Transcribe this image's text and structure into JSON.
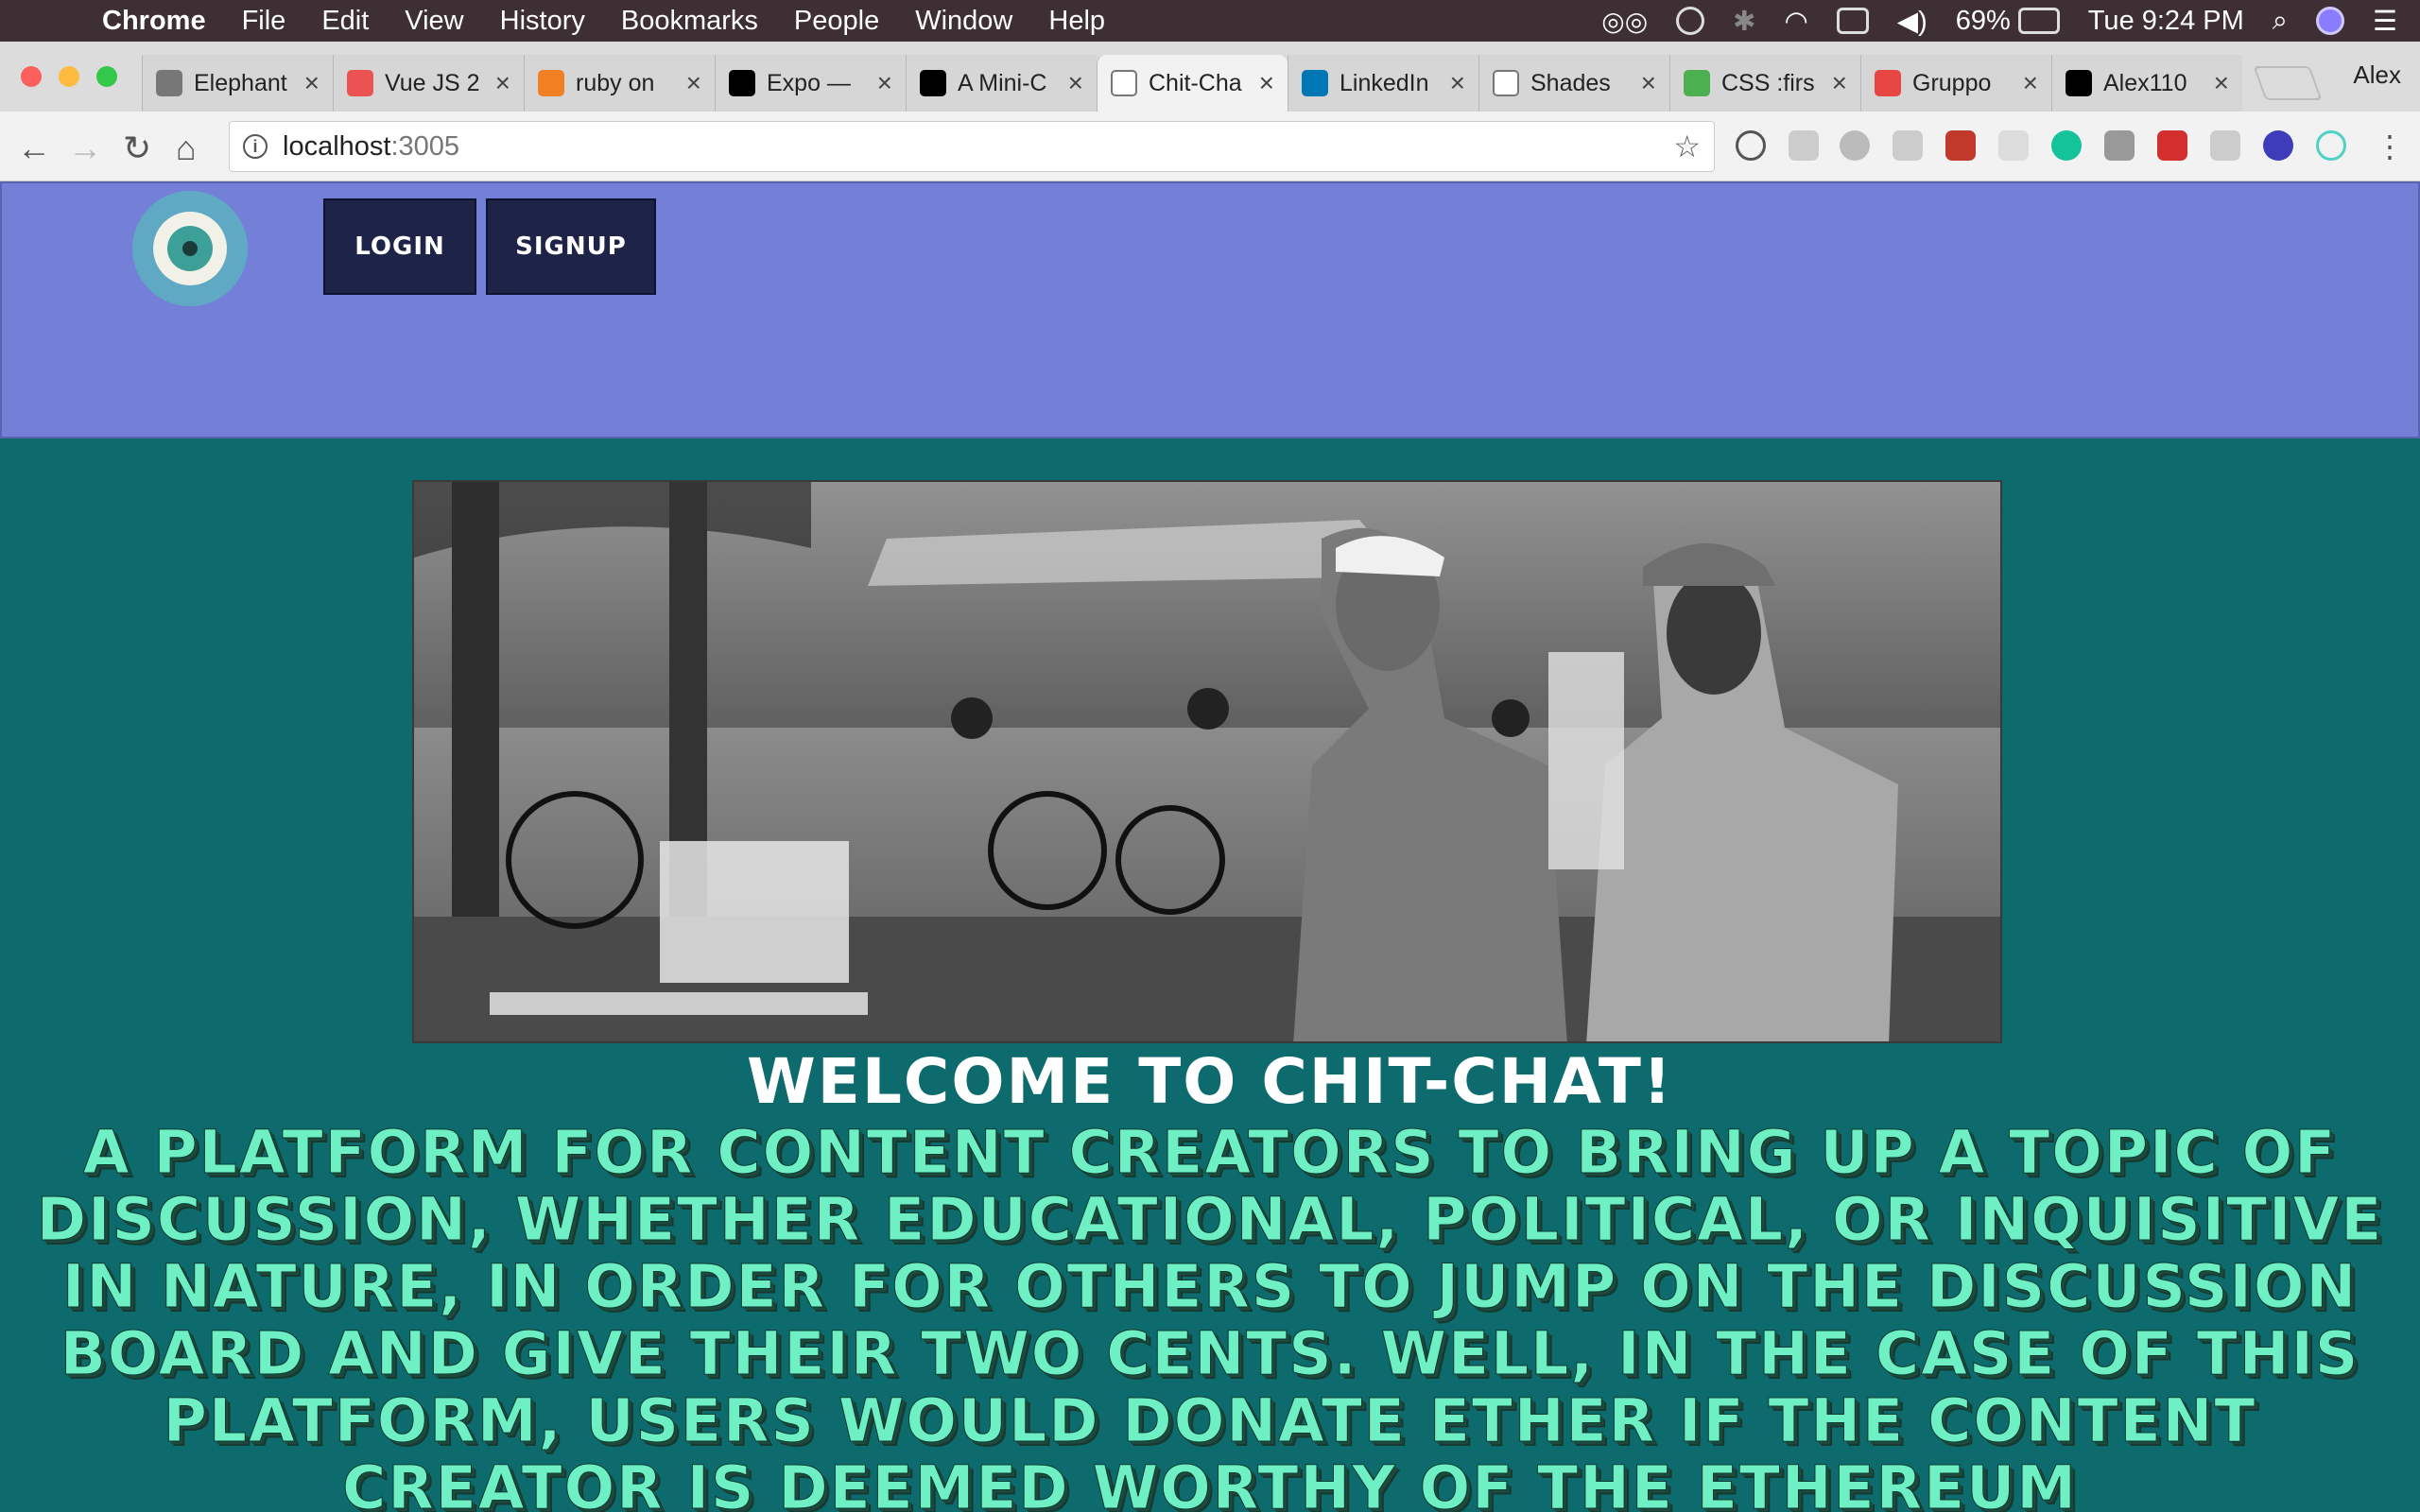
{
  "menubar": {
    "app": "Chrome",
    "items": [
      "File",
      "Edit",
      "View",
      "History",
      "Bookmarks",
      "People",
      "Window",
      "Help"
    ],
    "battery": "69%",
    "clock": "Tue 9:24 PM"
  },
  "tabs": [
    {
      "label": "Elephant",
      "icon": "elephant-icon",
      "color": "#777777"
    },
    {
      "label": "Vue JS 2",
      "icon": "udemy-icon",
      "color": "#ec5252"
    },
    {
      "label": "ruby on",
      "icon": "stackoverflow-icon",
      "color": "#f48024"
    },
    {
      "label": "Expo —",
      "icon": "expo-icon",
      "color": "#000000"
    },
    {
      "label": "A Mini-C",
      "icon": "medium-icon",
      "color": "#000000"
    },
    {
      "label": "Chit-Cha",
      "icon": "page-icon",
      "color": "#ffffff",
      "active": true
    },
    {
      "label": "LinkedIn",
      "icon": "linkedin-icon",
      "color": "#0077b5"
    },
    {
      "label": "Shades",
      "icon": "wikipedia-icon",
      "color": "#ffffff"
    },
    {
      "label": "CSS :firs",
      "icon": "w3schools-icon",
      "color": "#4caf50"
    },
    {
      "label": "Gruppo",
      "icon": "fontface-icon",
      "color": "#e84545"
    },
    {
      "label": "Alex110",
      "icon": "github-icon",
      "color": "#000000"
    }
  ],
  "profile": "Alex",
  "omnibox": {
    "host": "localhost",
    "port": ":3005"
  },
  "page": {
    "login": "Login",
    "signup": "Signup",
    "welcome": "Welcome to Chit-Chat!",
    "description": "A platform for content creators to bring up a topic of discussion, whether educational, political, or inquisitive in nature, in order for others to jump on the discussion board and give their two cents. Well, in the case of this platform, users would donate Ether if the content creator is deemed worthy of the Ethereum"
  },
  "colors": {
    "navbar": "#7480d8",
    "page_bg": "#0d6b6e",
    "button_bg": "#1d2447",
    "description_text": "#6ff0c4"
  }
}
